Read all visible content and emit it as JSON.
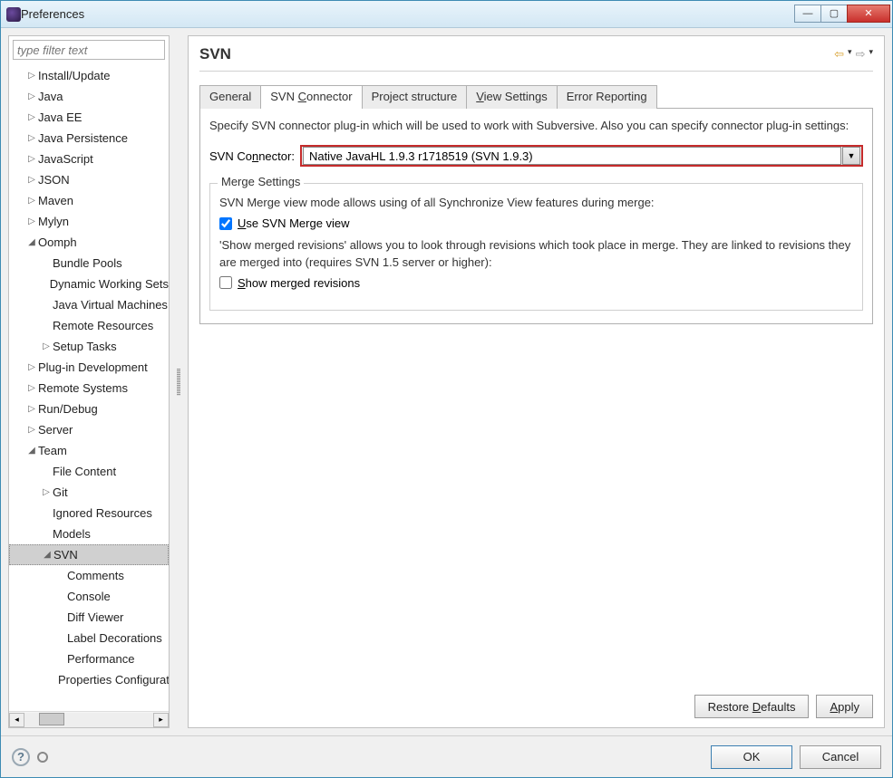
{
  "window": {
    "title": "Preferences"
  },
  "filter": {
    "placeholder": "type filter text"
  },
  "tree": [
    {
      "label": "Install/Update",
      "depth": 1,
      "twisty": "▷"
    },
    {
      "label": "Java",
      "depth": 1,
      "twisty": "▷"
    },
    {
      "label": "Java EE",
      "depth": 1,
      "twisty": "▷"
    },
    {
      "label": "Java Persistence",
      "depth": 1,
      "twisty": "▷"
    },
    {
      "label": "JavaScript",
      "depth": 1,
      "twisty": "▷"
    },
    {
      "label": "JSON",
      "depth": 1,
      "twisty": "▷"
    },
    {
      "label": "Maven",
      "depth": 1,
      "twisty": "▷"
    },
    {
      "label": "Mylyn",
      "depth": 1,
      "twisty": "▷"
    },
    {
      "label": "Oomph",
      "depth": 1,
      "twisty": "◢"
    },
    {
      "label": "Bundle Pools",
      "depth": 2,
      "twisty": ""
    },
    {
      "label": "Dynamic Working Sets",
      "depth": 2,
      "twisty": ""
    },
    {
      "label": "Java Virtual Machines",
      "depth": 2,
      "twisty": ""
    },
    {
      "label": "Remote Resources",
      "depth": 2,
      "twisty": ""
    },
    {
      "label": "Setup Tasks",
      "depth": 2,
      "twisty": "▷"
    },
    {
      "label": "Plug-in Development",
      "depth": 1,
      "twisty": "▷"
    },
    {
      "label": "Remote Systems",
      "depth": 1,
      "twisty": "▷"
    },
    {
      "label": "Run/Debug",
      "depth": 1,
      "twisty": "▷"
    },
    {
      "label": "Server",
      "depth": 1,
      "twisty": "▷"
    },
    {
      "label": "Team",
      "depth": 1,
      "twisty": "◢"
    },
    {
      "label": "File Content",
      "depth": 2,
      "twisty": ""
    },
    {
      "label": "Git",
      "depth": 2,
      "twisty": "▷"
    },
    {
      "label": "Ignored Resources",
      "depth": 2,
      "twisty": ""
    },
    {
      "label": "Models",
      "depth": 2,
      "twisty": ""
    },
    {
      "label": "SVN",
      "depth": 2,
      "twisty": "◢",
      "selected": true
    },
    {
      "label": "Comments",
      "depth": 3,
      "twisty": ""
    },
    {
      "label": "Console",
      "depth": 3,
      "twisty": ""
    },
    {
      "label": "Diff Viewer",
      "depth": 3,
      "twisty": ""
    },
    {
      "label": "Label Decorations",
      "depth": 3,
      "twisty": ""
    },
    {
      "label": "Performance",
      "depth": 3,
      "twisty": ""
    },
    {
      "label": "Properties Configuration",
      "depth": 3,
      "twisty": ""
    }
  ],
  "page": {
    "title": "SVN"
  },
  "tabs": {
    "general": "General",
    "connector_pre": "SVN ",
    "connector_u": "C",
    "connector_post": "onnector",
    "project": "Project structure",
    "view_u": "V",
    "view_post": "iew Settings",
    "error": "Error Reporting"
  },
  "panel": {
    "desc": "Specify SVN connector plug-in which will be used to work with Subversive. Also you can specify connector plug-in settings:",
    "connector_label_pre": "SVN Co",
    "connector_label_u": "n",
    "connector_label_post": "nector:",
    "connector_value": "Native JavaHL 1.9.3 r1718519 (SVN 1.9.3)",
    "merge": {
      "legend": "Merge Settings",
      "line1": "SVN Merge view mode allows using of all Synchronize View features during merge:",
      "chk1_u": "U",
      "chk1_post": "se SVN Merge view",
      "chk1_checked": true,
      "line2": "'Show merged revisions' allows you to look through revisions which took place in merge. They are linked to revisions they are merged into (requires SVN 1.5 server or higher):",
      "chk2_u": "S",
      "chk2_post": "how merged revisions",
      "chk2_checked": false
    }
  },
  "buttons": {
    "restore_pre": "Restore ",
    "restore_u": "D",
    "restore_post": "efaults",
    "apply_u": "A",
    "apply_post": "pply",
    "ok": "OK",
    "cancel": "Cancel"
  }
}
